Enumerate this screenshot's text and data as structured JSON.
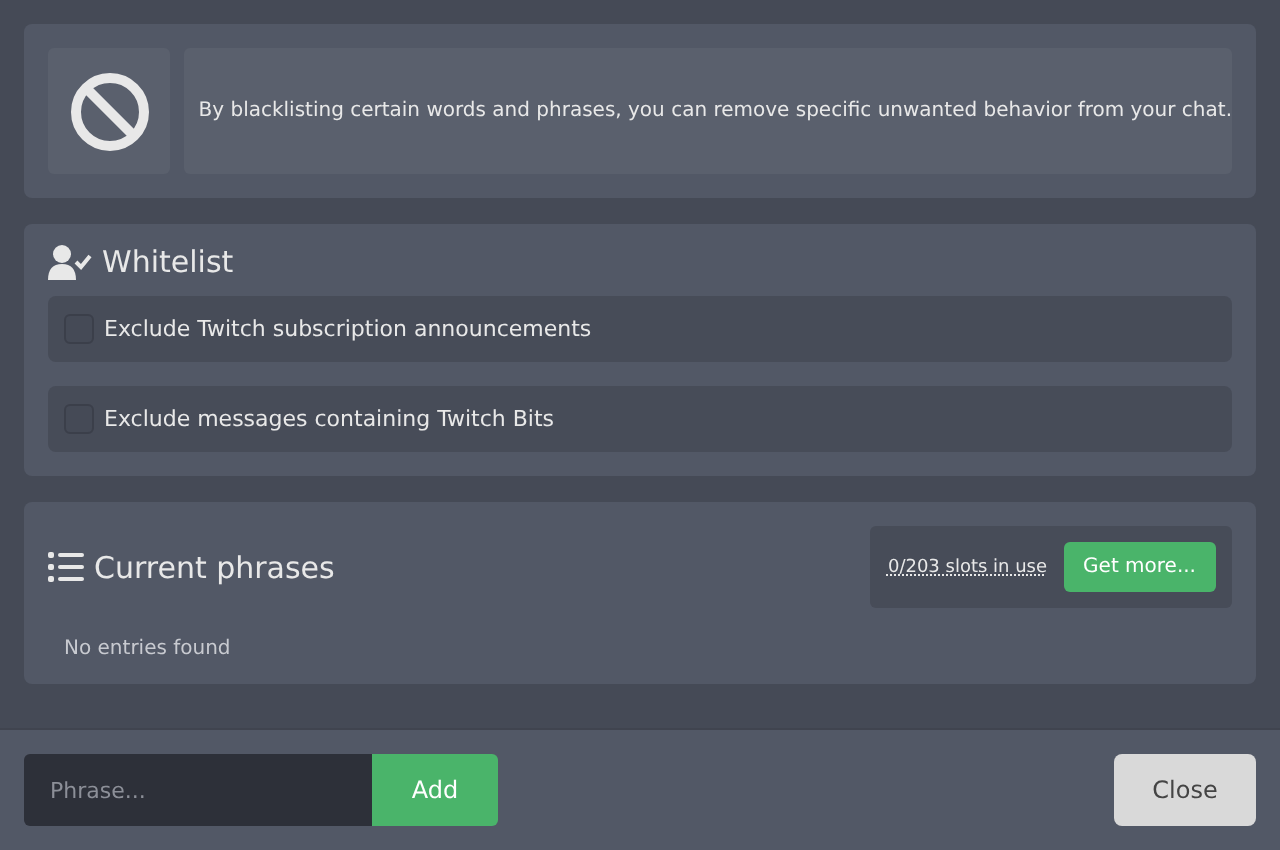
{
  "info": {
    "text": "By blacklisting certain words and phrases, you can remove specific unwanted behavior from your chat."
  },
  "whitelist": {
    "title": "Whitelist",
    "options": [
      {
        "label": "Exclude Twitch subscription announcements",
        "checked": false
      },
      {
        "label": "Exclude messages containing Twitch Bits",
        "checked": false
      }
    ]
  },
  "phrases": {
    "title": "Current phrases",
    "slots": "0/203 slots in use",
    "get_more": "Get more...",
    "empty": "No entries found"
  },
  "footer": {
    "placeholder": "Phrase...",
    "add": "Add",
    "close": "Close"
  }
}
